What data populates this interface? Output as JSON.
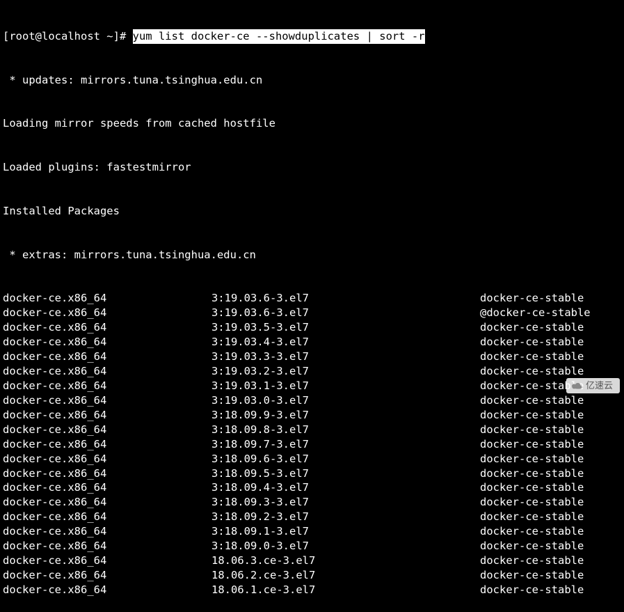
{
  "prompt": {
    "user_host": "[root@localhost ~]# ",
    "command": "yum list docker-ce --showduplicates | sort -r"
  },
  "header_lines": [
    " * updates: mirrors.tuna.tsinghua.edu.cn",
    "Loading mirror speeds from cached hostfile",
    "Loaded plugins: fastestmirror",
    "Installed Packages",
    " * extras: mirrors.tuna.tsinghua.edu.cn"
  ],
  "packages": [
    {
      "name": "docker-ce.x86_64",
      "version": "3:19.03.6-3.el7",
      "repo": "docker-ce-stable"
    },
    {
      "name": "docker-ce.x86_64",
      "version": "3:19.03.6-3.el7",
      "repo": "@docker-ce-stable"
    },
    {
      "name": "docker-ce.x86_64",
      "version": "3:19.03.5-3.el7",
      "repo": "docker-ce-stable"
    },
    {
      "name": "docker-ce.x86_64",
      "version": "3:19.03.4-3.el7",
      "repo": "docker-ce-stable"
    },
    {
      "name": "docker-ce.x86_64",
      "version": "3:19.03.3-3.el7",
      "repo": "docker-ce-stable"
    },
    {
      "name": "docker-ce.x86_64",
      "version": "3:19.03.2-3.el7",
      "repo": "docker-ce-stable"
    },
    {
      "name": "docker-ce.x86_64",
      "version": "3:19.03.1-3.el7",
      "repo": "docker-ce-stable"
    },
    {
      "name": "docker-ce.x86_64",
      "version": "3:19.03.0-3.el7",
      "repo": "docker-ce-stable"
    },
    {
      "name": "docker-ce.x86_64",
      "version": "3:18.09.9-3.el7",
      "repo": "docker-ce-stable"
    },
    {
      "name": "docker-ce.x86_64",
      "version": "3:18.09.8-3.el7",
      "repo": "docker-ce-stable"
    },
    {
      "name": "docker-ce.x86_64",
      "version": "3:18.09.7-3.el7",
      "repo": "docker-ce-stable"
    },
    {
      "name": "docker-ce.x86_64",
      "version": "3:18.09.6-3.el7",
      "repo": "docker-ce-stable"
    },
    {
      "name": "docker-ce.x86_64",
      "version": "3:18.09.5-3.el7",
      "repo": "docker-ce-stable"
    },
    {
      "name": "docker-ce.x86_64",
      "version": "3:18.09.4-3.el7",
      "repo": "docker-ce-stable"
    },
    {
      "name": "docker-ce.x86_64",
      "version": "3:18.09.3-3.el7",
      "repo": "docker-ce-stable"
    },
    {
      "name": "docker-ce.x86_64",
      "version": "3:18.09.2-3.el7",
      "repo": "docker-ce-stable"
    },
    {
      "name": "docker-ce.x86_64",
      "version": "3:18.09.1-3.el7",
      "repo": "docker-ce-stable"
    },
    {
      "name": "docker-ce.x86_64",
      "version": "3:18.09.0-3.el7",
      "repo": "docker-ce-stable"
    },
    {
      "name": "docker-ce.x86_64",
      "version": "18.06.3.ce-3.el7",
      "repo": "docker-ce-stable"
    },
    {
      "name": "docker-ce.x86_64",
      "version": "18.06.2.ce-3.el7",
      "repo": "docker-ce-stable"
    },
    {
      "name": "docker-ce.x86_64",
      "version": "18.06.1.ce-3.el7",
      "repo": "docker-ce-stable"
    }
  ],
  "watermark": {
    "text": "亿速云"
  }
}
